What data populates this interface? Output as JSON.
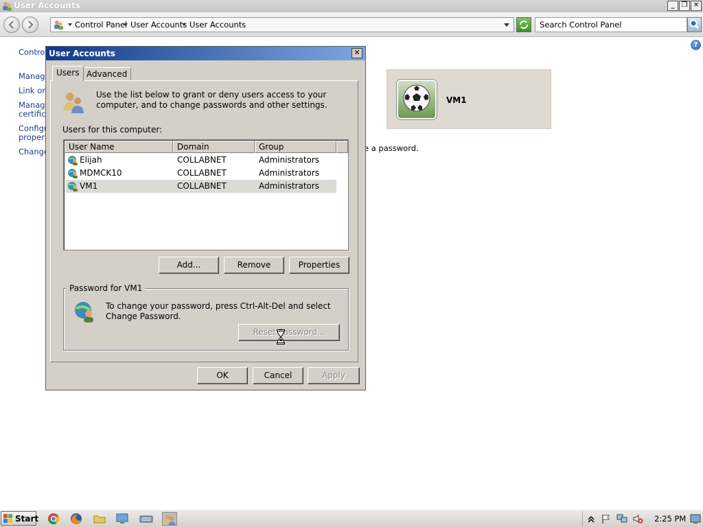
{
  "window": {
    "title": "User Accounts"
  },
  "address_bar": {
    "crumbs": [
      "Control Panel",
      "User Accounts",
      "User Accounts"
    ],
    "search_placeholder": "Search Control Panel"
  },
  "background": {
    "links": [
      "Control",
      "Manage",
      "Link onli",
      "Manage",
      "certifica",
      "Configu",
      "properti",
      "Change"
    ],
    "partial_text": "e a password.",
    "user_tile_name": "VM1"
  },
  "dialog": {
    "title": "User Accounts",
    "tabs": [
      "Users",
      "Advanced"
    ],
    "intro": "Use the list below to grant or deny users access to your computer, and to change passwords and other settings.",
    "users_label": "Users for this computer:",
    "columns": [
      "User Name",
      "Domain",
      "Group"
    ],
    "users": [
      {
        "name": "Elijah",
        "domain": "COLLABNET",
        "group": "Administrators"
      },
      {
        "name": "MDMCK10",
        "domain": "COLLABNET",
        "group": "Administrators"
      },
      {
        "name": "VM1",
        "domain": "COLLABNET",
        "group": "Administrators"
      }
    ],
    "selected_user": "VM1",
    "buttons": {
      "add": "Add...",
      "remove": "Remove",
      "properties": "Properties"
    },
    "password_group": "Password for VM1",
    "password_text": "To change your password, press Ctrl-Alt-Del and select Change Password.",
    "reset_password": "Reset Password...",
    "footer": {
      "ok": "OK",
      "cancel": "Cancel",
      "apply": "Apply"
    }
  },
  "taskbar": {
    "start": "Start",
    "clock": "2:25 PM"
  }
}
